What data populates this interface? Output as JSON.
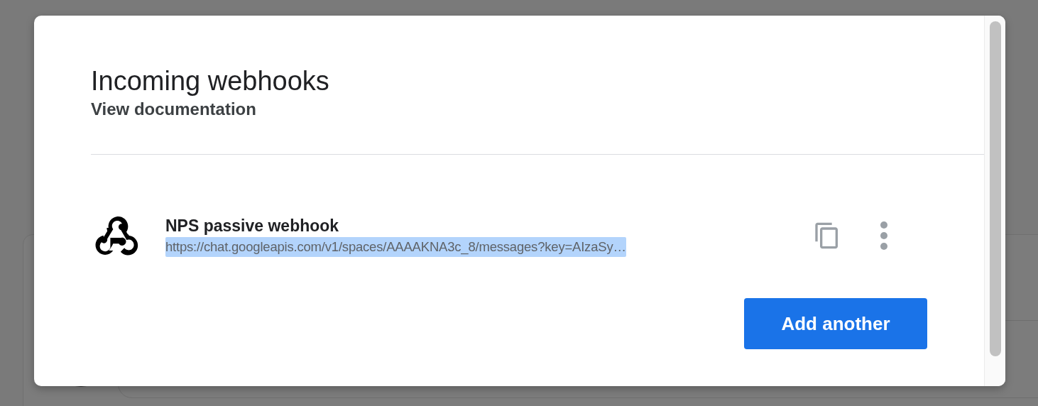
{
  "dialog": {
    "title": "Incoming webhooks",
    "link": "View documentation",
    "webhooks": [
      {
        "name": "NPS passive webhook",
        "url": "https://chat.googleapis.com/v1/spaces/AAAAKNA3c_8/messages?key=AIzaSy…",
        "highlighted": true
      }
    ],
    "button": "Add another"
  }
}
